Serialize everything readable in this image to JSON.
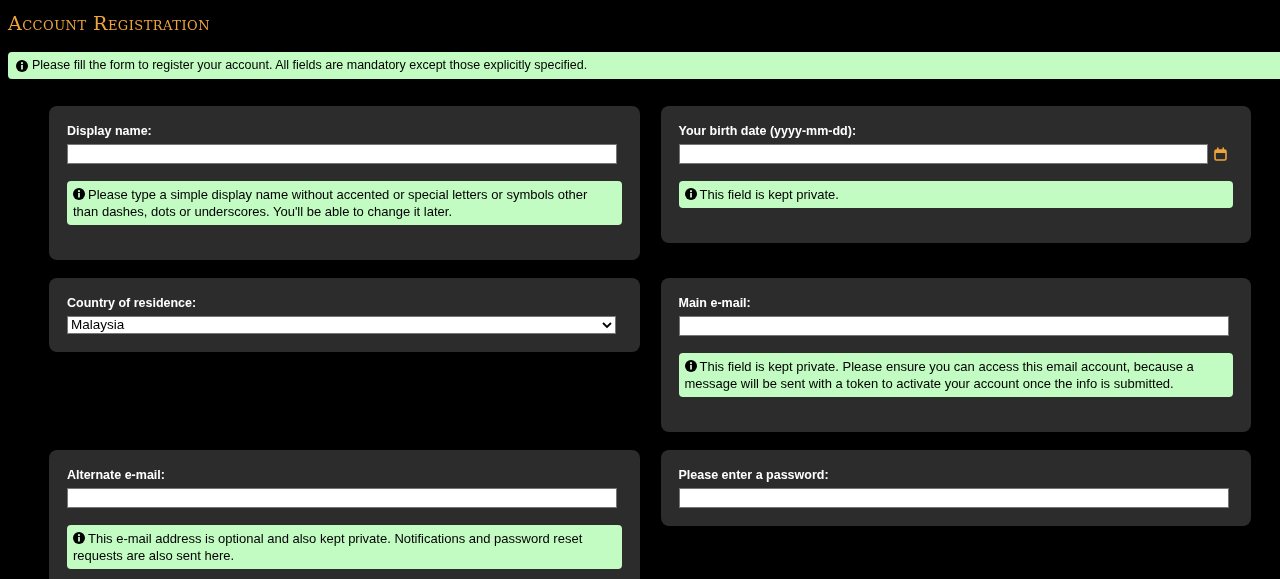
{
  "title": "Account Registration",
  "notice": "Please fill the form to register your account. All fields are mandatory except those explicitly specified.",
  "fields": [
    {
      "kind": "text",
      "label": "Display name:",
      "info": "Please type a simple display name without accented or special letters or symbols other than dashes, dots or underscores. You'll be able to change it later."
    },
    {
      "kind": "date",
      "label": "Your birth date (yyyy-mm-dd):",
      "info": "This field is kept private."
    },
    {
      "kind": "select",
      "label": "Country of residence:",
      "value": "Malaysia"
    },
    {
      "kind": "text",
      "label": "Main e-mail:",
      "info": "This field is kept private. Please ensure you can access this email account, because a message will be sent with a token to activate your account once the info is submitted."
    },
    {
      "kind": "text",
      "label": "Alternate e-mail:",
      "info": "This e-mail address is optional and also kept private. Notifications and password reset requests are also sent here."
    },
    {
      "kind": "password",
      "label": "Please enter a password:"
    }
  ]
}
